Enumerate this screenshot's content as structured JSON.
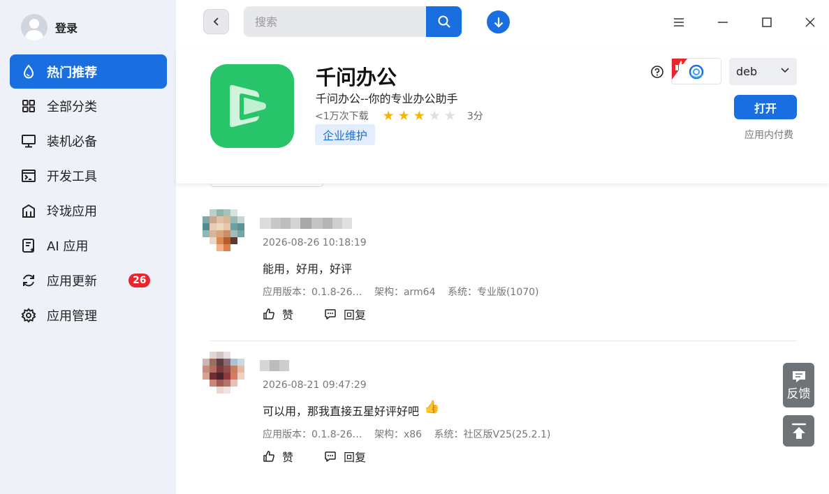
{
  "sidebar": {
    "login_label": "登录",
    "items": [
      {
        "label": "热门推荐",
        "icon": "drop-icon",
        "active": true
      },
      {
        "label": "全部分类",
        "icon": "grid-icon"
      },
      {
        "label": "装机必备",
        "icon": "monitor-icon"
      },
      {
        "label": "开发工具",
        "icon": "terminal-icon"
      },
      {
        "label": "玲珑应用",
        "icon": "building-icon"
      },
      {
        "label": "AI 应用",
        "icon": "ai-doc-icon"
      },
      {
        "label": "应用更新",
        "icon": "refresh-icon",
        "badge": "26"
      },
      {
        "label": "应用管理",
        "icon": "gear-icon"
      }
    ]
  },
  "topbar": {
    "search_placeholder": "搜索"
  },
  "app": {
    "name": "千问办公",
    "description": "千问办公--你的专业办公助手",
    "downloads": "<1万次下载",
    "rating": 3,
    "rating_max": 5,
    "score_label": "3分",
    "tag": "企业维护",
    "format": "deb",
    "open_label": "打开",
    "payment_note": "应用内付费"
  },
  "reviews": [
    {
      "date": "2026-08-26 10:18:19",
      "text": "能用，好用，好评",
      "version": "应用版本：0.1.8-26…",
      "arch": "架构：arm64",
      "system": "系统：专业版(1070)",
      "like_label": "赞",
      "reply_label": "回复"
    },
    {
      "date": "2026-08-21 09:47:29",
      "text": "可以用，那我直接五星好评好吧",
      "emoji": "👍",
      "version": "应用版本：0.1.8-26…",
      "arch": "架构：x86",
      "system": "系统：社区版V25(25.2.1)",
      "like_label": "赞",
      "reply_label": "回复"
    }
  ],
  "floating": {
    "feedback_label": "反馈"
  },
  "colors": {
    "accent": "#1a6fe0",
    "app_icon_bg": "#27c46a",
    "sidebar_bg": "#eef2f8",
    "badge": "#e8242c",
    "star": "#f7b500"
  }
}
